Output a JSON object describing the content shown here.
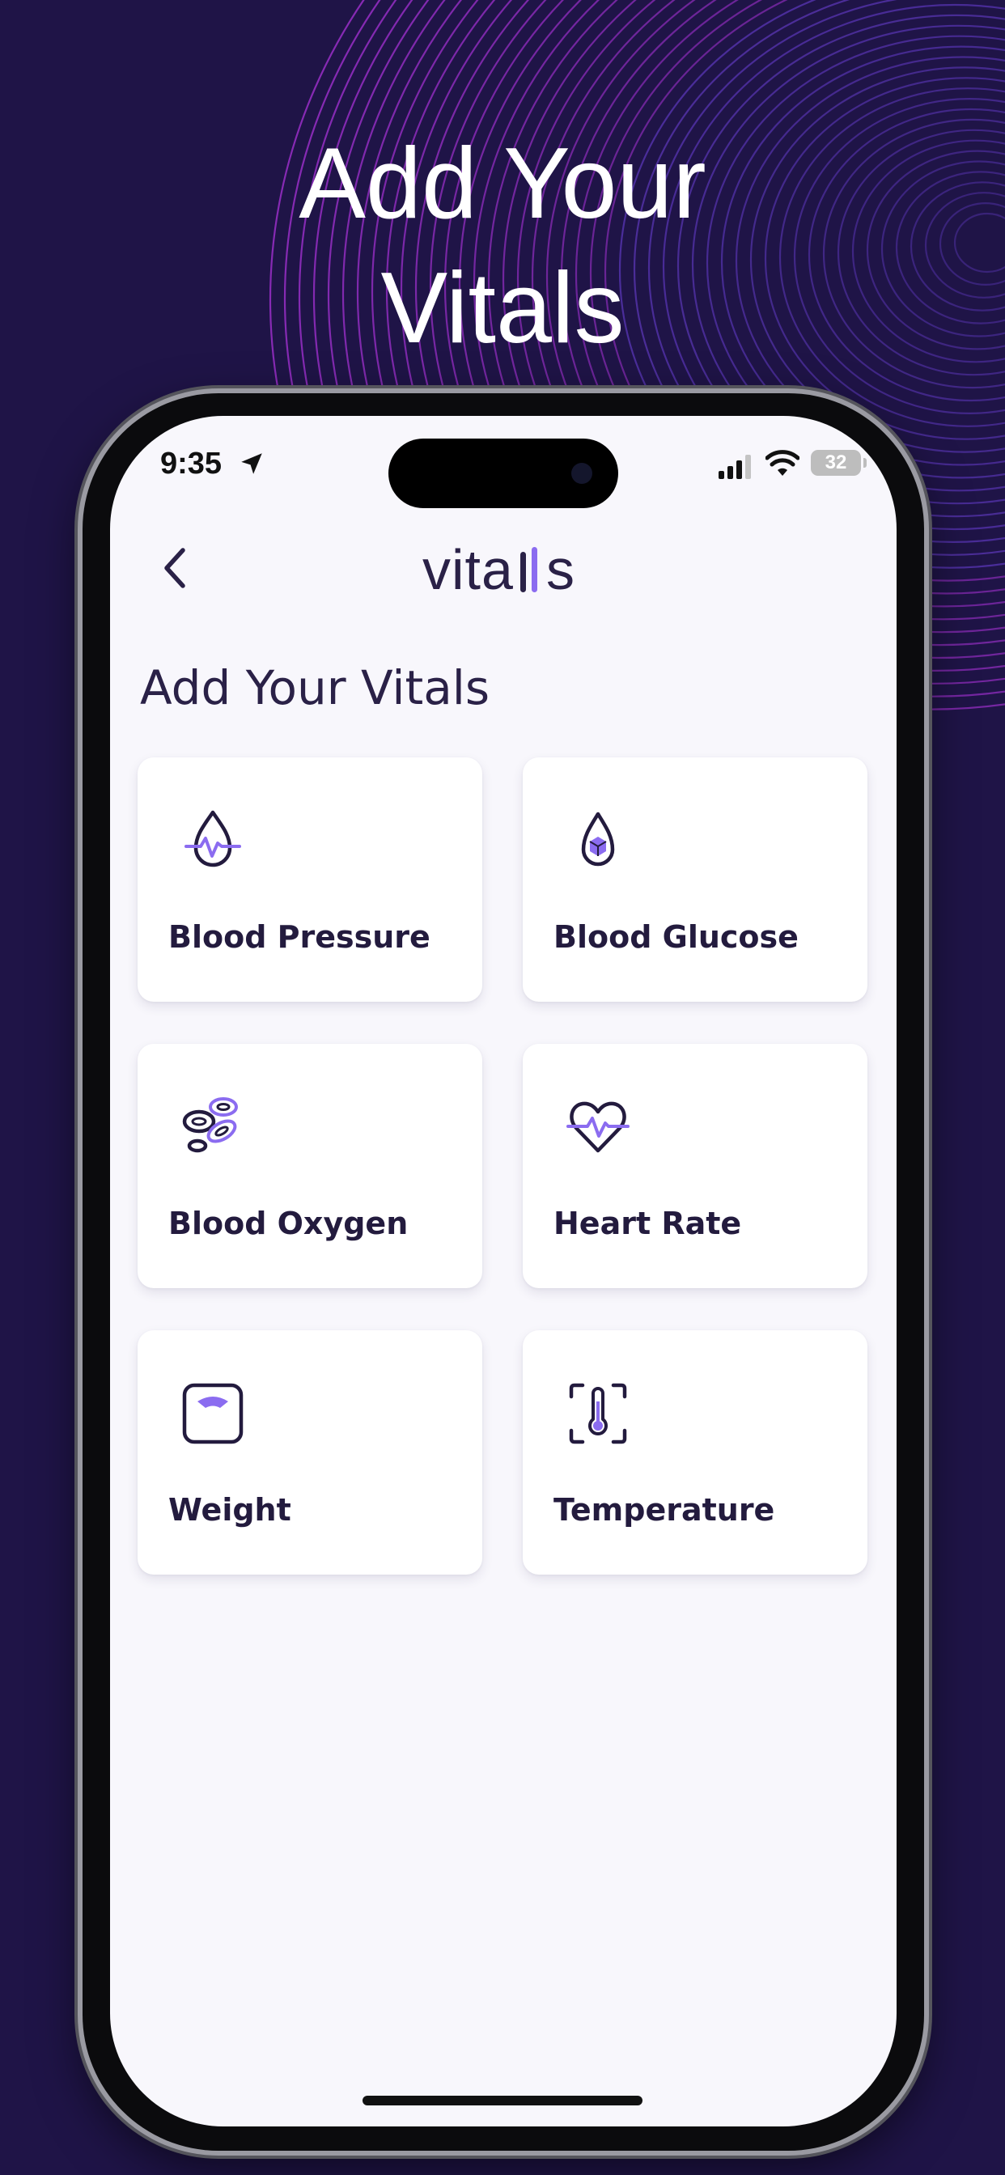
{
  "promo": {
    "title_line1": "Add Your",
    "title_line2": "Vitals"
  },
  "status_bar": {
    "time": "9:35",
    "battery": "32"
  },
  "header": {
    "logo": "vitalls"
  },
  "page": {
    "title": "Add Your Vitals"
  },
  "cards": [
    {
      "label": "Blood Pressure",
      "icon": "blood-pressure-icon"
    },
    {
      "label": "Blood Glucose",
      "icon": "blood-glucose-icon"
    },
    {
      "label": "Blood Oxygen",
      "icon": "blood-oxygen-icon"
    },
    {
      "label": "Heart Rate",
      "icon": "heart-rate-icon"
    },
    {
      "label": "Weight",
      "icon": "weight-scale-icon"
    },
    {
      "label": "Temperature",
      "icon": "thermometer-icon"
    }
  ],
  "colors": {
    "background": "#1f1447",
    "accent": "#8b6cf0",
    "ink": "#231b3e",
    "screen": "#f8f7fc"
  }
}
